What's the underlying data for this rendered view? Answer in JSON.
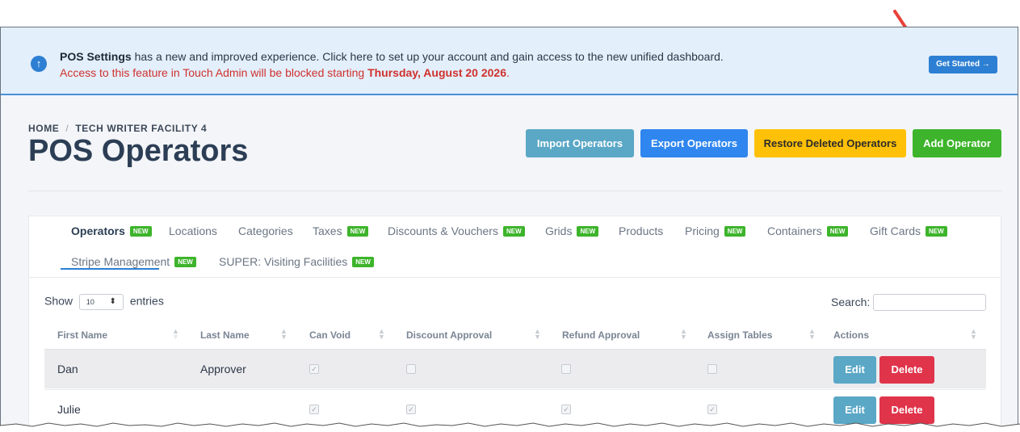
{
  "banner": {
    "bold": "POS Settings",
    "text": " has a new and improved experience. Click here to set up your account and gain access to the new unified dashboard.",
    "warning_prefix": "Access to this feature in Touch Admin will be blocked starting ",
    "warning_date": "Thursday, August 20 2026",
    "warning_suffix": ".",
    "button_label": "Get Started →",
    "icon": "arrow-up-circle-icon"
  },
  "breadcrumb": {
    "home": "HOME",
    "separator": "/",
    "current": "TECH WRITER FACILITY 4"
  },
  "page_title": "POS Operators",
  "actions": {
    "import": "Import Operators",
    "export": "Export Operators",
    "restore": "Restore Deleted Operators",
    "add": "Add Operator"
  },
  "tabs": [
    {
      "label": "Operators",
      "badge": "NEW"
    },
    {
      "label": "Locations"
    },
    {
      "label": "Categories"
    },
    {
      "label": "Taxes",
      "badge": "NEW"
    },
    {
      "label": "Discounts & Vouchers",
      "badge": "NEW"
    },
    {
      "label": "Grids",
      "badge": "NEW"
    },
    {
      "label": "Products"
    },
    {
      "label": "Pricing",
      "badge": "NEW"
    },
    {
      "label": "Containers",
      "badge": "NEW"
    },
    {
      "label": "Gift Cards",
      "badge": "NEW"
    },
    {
      "label": "Stripe Management",
      "badge": "NEW"
    },
    {
      "label": "SUPER: Visiting Facilities",
      "badge": "NEW"
    }
  ],
  "table_controls": {
    "show": "Show",
    "entries_value": "10",
    "entries": "entries",
    "search": "Search:"
  },
  "columns": [
    "First Name",
    "Last Name",
    "Can Void",
    "Discount Approval",
    "Refund Approval",
    "Assign Tables",
    "Actions"
  ],
  "rows": [
    {
      "first": "Dan",
      "last": "Approver",
      "can_void": true,
      "discount": false,
      "refund": false,
      "assign": false,
      "edit": "Edit",
      "delete": "Delete"
    },
    {
      "first": "Julie",
      "last": "",
      "can_void": true,
      "discount": true,
      "refund": true,
      "assign": true,
      "edit": "Edit",
      "delete": "Delete"
    }
  ],
  "colors": {
    "primary": "#2d7fd3",
    "info": "#5aa7c6",
    "warning": "#ffc107",
    "success": "#3db42b",
    "danger": "#e0344a",
    "alert_text": "#d0312d"
  }
}
